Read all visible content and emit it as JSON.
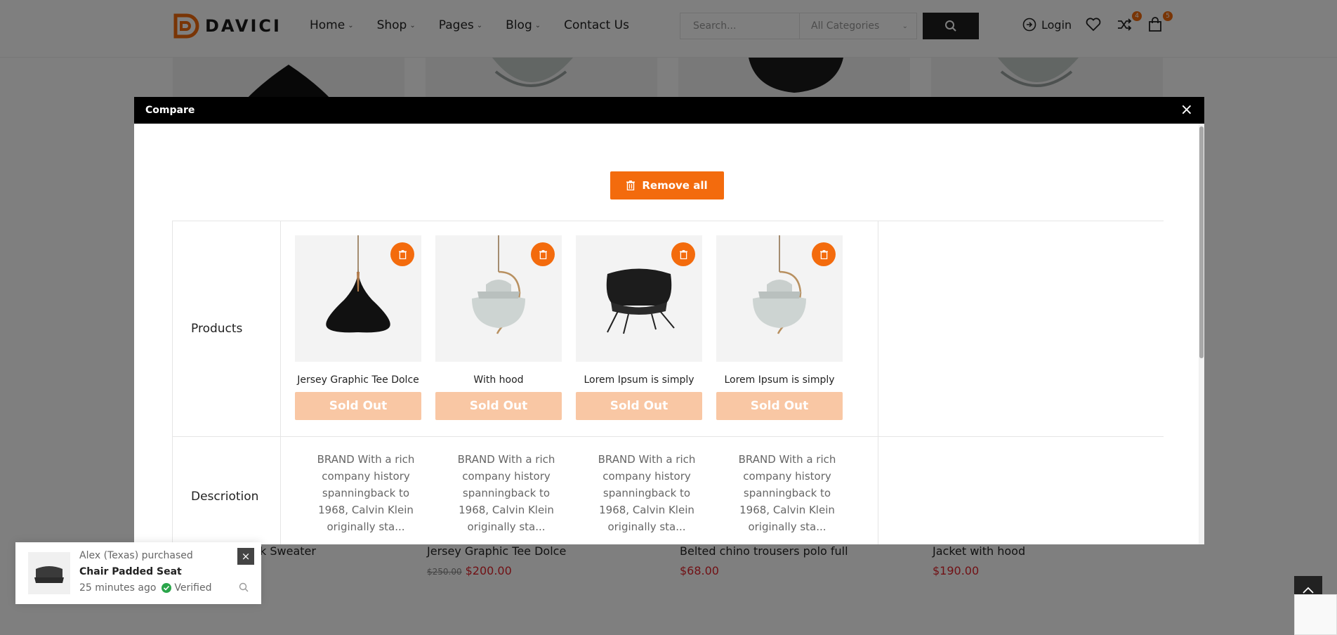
{
  "header": {
    "logo_text": "DAVICI",
    "nav": [
      {
        "label": "Home"
      },
      {
        "label": "Shop"
      },
      {
        "label": "Pages"
      },
      {
        "label": "Blog"
      },
      {
        "label": "Contact Us"
      }
    ],
    "search_placeholder": "Search...",
    "category_select": "All Categories",
    "login_label": "Login",
    "compare_count": "4",
    "cart_count": "5"
  },
  "background_products": [
    {
      "title": "k Sweater",
      "price": ""
    },
    {
      "title": "Jersey Graphic Tee Dolce",
      "old_price": "$250.00",
      "price": "$200.00"
    },
    {
      "title": "Belted chino trousers polo full",
      "price": "$68.00"
    },
    {
      "title": "Jacket with hood",
      "price": "$190.00"
    }
  ],
  "modal": {
    "title": "Compare",
    "close_icon": "×",
    "remove_all_label": "Remove all",
    "rows": {
      "products_label": "Products",
      "description_label": "Descriotion"
    },
    "products": [
      {
        "name": "Jersey Graphic Tee Dolce",
        "button": "Sold Out",
        "image": "pendant-lamp-black",
        "description": "BRAND With a rich company history spanningback to 1968, Calvin Klein originally sta..."
      },
      {
        "name": "With hood",
        "button": "Sold Out",
        "image": "pendant-lamp-gray",
        "description": "BRAND With a rich company history spanningback to 1968, Calvin Klein originally sta..."
      },
      {
        "name": "Lorem Ipsum is simply",
        "button": "Sold Out",
        "image": "lounge-chair-black",
        "description": "BRAND With a rich company history spanningback to 1968, Calvin Klein originally sta..."
      },
      {
        "name": "Lorem Ipsum is simply",
        "button": "Sold Out",
        "image": "pendant-lamp-gray",
        "description": "BRAND With a rich company history spanningback to 1968, Calvin Klein originally sta..."
      }
    ]
  },
  "notification": {
    "line1": "Alex (Texas) purchased",
    "product": "Chair Padded Seat",
    "time": "25 minutes ago",
    "verified": "Verified"
  },
  "colors": {
    "accent": "#f36b0d",
    "sold_out": "#f9c7a4",
    "price": "#e2222a"
  }
}
